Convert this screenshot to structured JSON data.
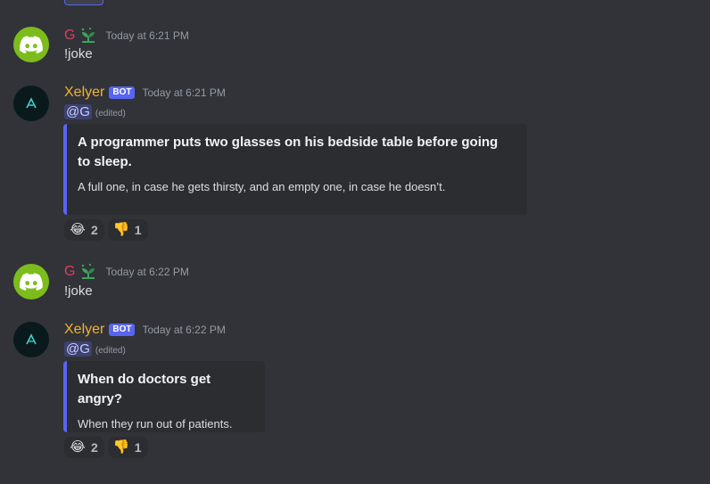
{
  "messages": [
    {
      "username": "G",
      "timestamp": "Today at 6:21 PM",
      "content": "!joke"
    },
    {
      "username": "Xelyer",
      "bot_tag": "BOT",
      "timestamp": "Today at 6:21 PM",
      "mention": "@G",
      "edited": "(edited)",
      "embed_title": "A programmer puts two glasses on his bedside table before going to sleep.",
      "embed_desc": "A full one, in case he gets thirsty, and an empty one, in case he doesn’t.",
      "reactions": [
        {
          "emoji": "😂",
          "count": "2"
        },
        {
          "emoji": "👎",
          "count": "1"
        }
      ]
    },
    {
      "username": "G",
      "timestamp": "Today at 6:22 PM",
      "content": "!joke"
    },
    {
      "username": "Xelyer",
      "bot_tag": "BOT",
      "timestamp": "Today at 6:22 PM",
      "mention": "@G",
      "edited": "(edited)",
      "embed_title": "When do doctors get angry?",
      "embed_desc": "When they run out of patients.",
      "reactions": [
        {
          "emoji": "😂",
          "count": "2"
        },
        {
          "emoji": "👎",
          "count": "1"
        }
      ]
    }
  ],
  "colors": {
    "background": "#313338",
    "embed_background": "#2b2d31",
    "embed_accent": "#5865f2",
    "g_name": "#e33b5c",
    "bot_name": "#f0b232",
    "bot_tag": "#5865f2",
    "discord_avatar": "#7cbc1c",
    "timestamp": "#949ba4"
  },
  "icons": {
    "discord_avatar": "discord-logo-icon",
    "bot_avatar": "xelyer-logo-icon",
    "role_icon": "sprout-icon"
  }
}
